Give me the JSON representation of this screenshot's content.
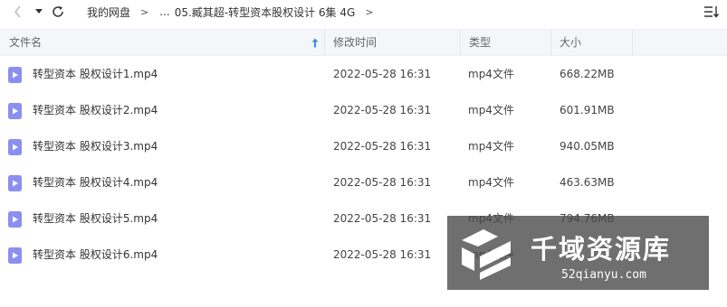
{
  "toolbar": {
    "breadcrumb": [
      {
        "label": "我的网盘"
      },
      {
        "label": "..."
      },
      {
        "label": "05.臧其超-转型资本股权设计 6集 4G"
      }
    ]
  },
  "table": {
    "columns": {
      "name": "文件名",
      "date": "修改时间",
      "type": "类型",
      "size": "大小"
    },
    "rows": [
      {
        "name": "转型资本 股权设计1.mp4",
        "date": "2022-05-28 16:31",
        "type": "mp4文件",
        "size": "668.22MB"
      },
      {
        "name": "转型资本 股权设计2.mp4",
        "date": "2022-05-28 16:31",
        "type": "mp4文件",
        "size": "601.91MB"
      },
      {
        "name": "转型资本 股权设计3.mp4",
        "date": "2022-05-28 16:31",
        "type": "mp4文件",
        "size": "940.05MB"
      },
      {
        "name": "转型资本 股权设计4.mp4",
        "date": "2022-05-28 16:31",
        "type": "mp4文件",
        "size": "463.63MB"
      },
      {
        "name": "转型资本 股权设计5.mp4",
        "date": "2022-05-28 16:31",
        "type": "mp4文件",
        "size": "794.76MB"
      },
      {
        "name": "转型资本 股权设计6.mp4",
        "date": "2022-05-28 16:31",
        "type": "mp4文件",
        "size": ""
      }
    ]
  },
  "watermark": {
    "title": "千域资源库",
    "url": "52qianyu.com"
  },
  "icons": {
    "back": "chevron-left-icon",
    "dropdown": "caret-down-icon",
    "refresh": "refresh-icon",
    "sort": "sort-list-icon",
    "video": "video-file-icon"
  },
  "colors": {
    "video_icon": "#8b8ff0",
    "sort_arrow": "#3b8ee8",
    "header_bg": "#f4f6f9"
  }
}
